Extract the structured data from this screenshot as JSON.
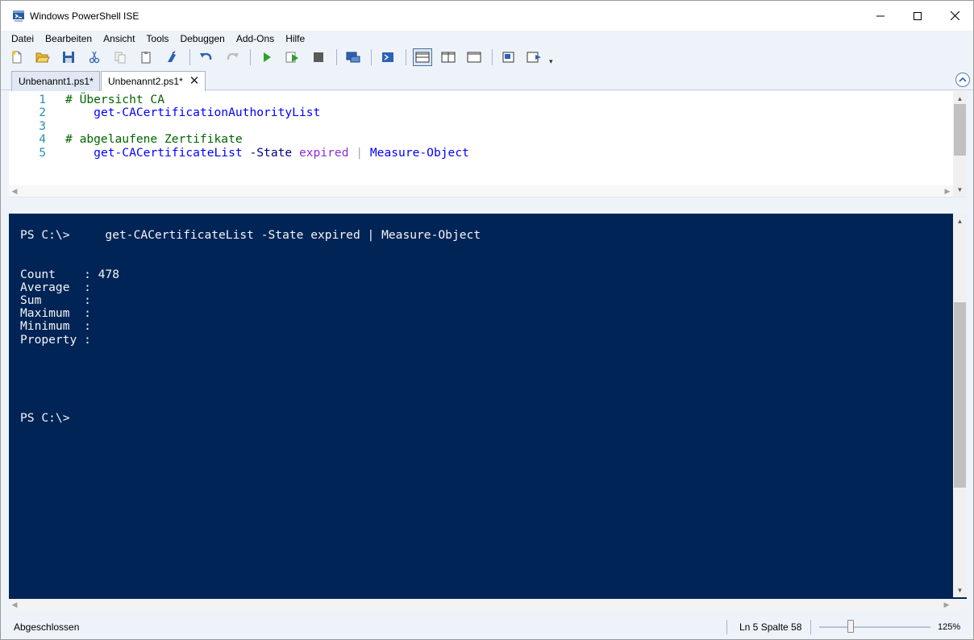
{
  "window": {
    "title": "Windows PowerShell ISE",
    "controls": [
      "minimize-icon",
      "maximize-icon",
      "close-icon"
    ]
  },
  "menu": {
    "items": [
      "Datei",
      "Bearbeiten",
      "Ansicht",
      "Tools",
      "Debuggen",
      "Add-Ons",
      "Hilfe"
    ]
  },
  "toolbar": {
    "buttons": [
      {
        "icon": "new-file-icon"
      },
      {
        "icon": "open-folder-icon"
      },
      {
        "icon": "save-icon"
      },
      {
        "icon": "cut-icon"
      },
      {
        "icon": "copy-icon"
      },
      {
        "icon": "paste-icon"
      },
      {
        "icon": "clear-console-icon"
      },
      {
        "icon": "undo-icon"
      },
      {
        "icon": "redo-icon"
      },
      {
        "icon": "run-script-icon"
      },
      {
        "icon": "run-selection-icon"
      },
      {
        "icon": "stop-icon"
      },
      {
        "icon": "remote-powershell-icon"
      },
      {
        "icon": "powershell-console-icon"
      },
      {
        "icon": "layout-top-icon"
      },
      {
        "icon": "layout-right-icon"
      },
      {
        "icon": "layout-max-icon"
      },
      {
        "icon": "show-commands-icon"
      },
      {
        "icon": "show-addon-icon"
      }
    ],
    "more": "▾"
  },
  "tabs": [
    {
      "label": "Unbenannt1.ps1*",
      "active": false
    },
    {
      "label": "Unbenannt2.ps1*",
      "active": true,
      "close": "✕"
    }
  ],
  "script": {
    "lines": [
      {
        "number": "1",
        "tokens": [
          {
            "text": "# Übersicht CA",
            "kind": "comment"
          }
        ]
      },
      {
        "number": "2",
        "tokens": [
          {
            "text": "    ",
            "kind": "plain"
          },
          {
            "text": "get-CACertificationAuthorityList",
            "kind": "cmd"
          }
        ]
      },
      {
        "number": "3",
        "tokens": []
      },
      {
        "number": "4",
        "tokens": [
          {
            "text": "# abgelaufene Zertifikate",
            "kind": "comment"
          }
        ]
      },
      {
        "number": "5",
        "tokens": [
          {
            "text": "    ",
            "kind": "plain"
          },
          {
            "text": "get-CACertificateList",
            "kind": "cmd"
          },
          {
            "text": " ",
            "kind": "plain"
          },
          {
            "text": "-State",
            "kind": "param"
          },
          {
            "text": " ",
            "kind": "plain"
          },
          {
            "text": "expired",
            "kind": "arg"
          },
          {
            "text": " ",
            "kind": "plain"
          },
          {
            "text": "|",
            "kind": "op"
          },
          {
            "text": " ",
            "kind": "plain"
          },
          {
            "text": "Measure-Object",
            "kind": "cmd"
          }
        ]
      }
    ]
  },
  "console": {
    "lines": [
      "PS C:\\>     get-CACertificateList -State expired | Measure-Object",
      "",
      "",
      "Count    : 478",
      "Average  :",
      "Sum      :",
      "Maximum  :",
      "Minimum  :",
      "Property :",
      "",
      "",
      "",
      "",
      "",
      "PS C:\\>"
    ]
  },
  "status": {
    "state": "Abgeschlossen",
    "position": "Ln 5  Spalte 58",
    "zoom": "125%",
    "zoom_level": 0.28
  }
}
